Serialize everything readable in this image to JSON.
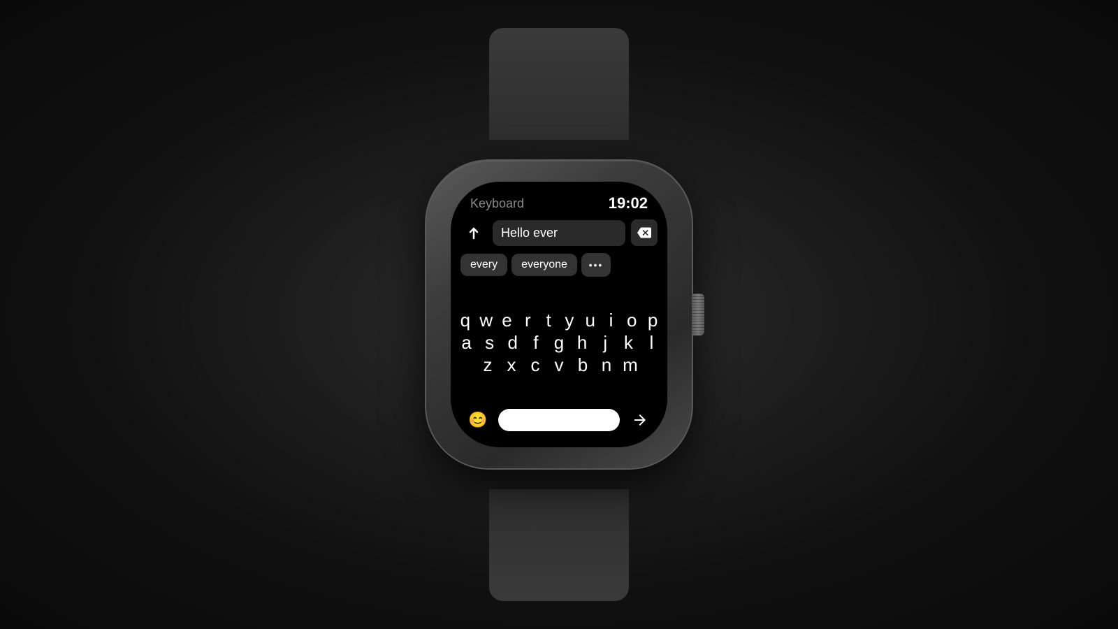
{
  "header": {
    "title": "Keyboard",
    "time": "19:02"
  },
  "input": {
    "text": "Hello ever"
  },
  "suggestions": [
    {
      "id": "every",
      "label": "every"
    },
    {
      "id": "everyone",
      "label": "everyone"
    }
  ],
  "more_label": "•••",
  "keyboard": {
    "rows": [
      [
        "q",
        "w",
        "e",
        "r",
        "t",
        "y",
        "u",
        "i",
        "o",
        "p"
      ],
      [
        "a",
        "s",
        "d",
        "f",
        "g",
        "h",
        "j",
        "k",
        "l"
      ],
      [
        "z",
        "x",
        "c",
        "v",
        "b",
        "n",
        "m"
      ]
    ]
  },
  "bottom": {
    "emoji_icon": "😊",
    "send_icon": "➤"
  },
  "colors": {
    "background": "#1a1a1a",
    "screen_bg": "#000000",
    "case_bg": "#3c3c3c",
    "text_primary": "#ffffff",
    "text_secondary": "#8a8a8a",
    "suggestion_bg": "#333333"
  }
}
